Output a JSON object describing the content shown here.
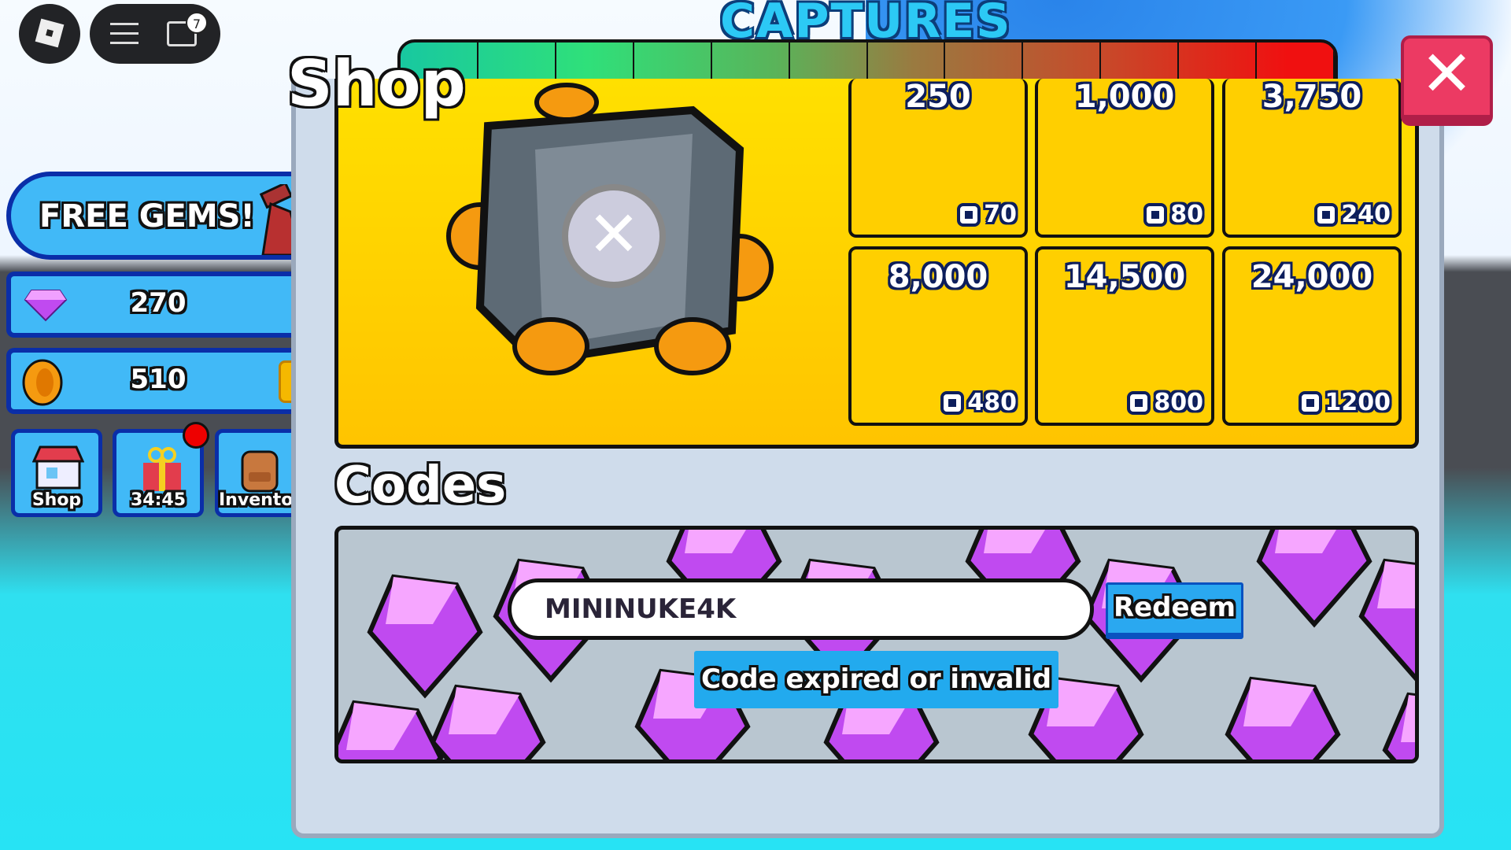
{
  "topbar": {
    "roblox_icon": "roblox-logo-icon",
    "menu_icon": "hamburger-icon",
    "chat_icon": "chat-icon",
    "chat_badge": "7"
  },
  "hud": {
    "title": "CAPTURES"
  },
  "left": {
    "free_gems": "FREE GEMS!",
    "gems": "270",
    "coins": "510",
    "buttons": [
      {
        "label": "Shop",
        "icon": "shop-icon"
      },
      {
        "label": "34:45",
        "icon": "gift-icon",
        "notification": true
      },
      {
        "label": "Inventory",
        "icon": "backpack-icon"
      }
    ]
  },
  "shop": {
    "title": "Shop",
    "close_icon": "close-icon",
    "coin_packs": [
      {
        "amount": "250",
        "price": "70"
      },
      {
        "amount": "1,000",
        "price": "80"
      },
      {
        "amount": "3,750",
        "price": "240"
      },
      {
        "amount": "8,000",
        "price": "480"
      },
      {
        "amount": "14,500",
        "price": "800"
      },
      {
        "amount": "24,000",
        "price": "1200"
      }
    ],
    "currency_icon": "robux-icon"
  },
  "codes": {
    "title": "Codes",
    "input_value": "MININUKE4K",
    "redeem_label": "Redeem",
    "status": "Code expired or invalid"
  },
  "colors": {
    "accent_blue": "#41b9f7",
    "close_pink": "#ec3a63",
    "banner_yellow": "#ffd000",
    "gem_purple": "#c04af0"
  }
}
